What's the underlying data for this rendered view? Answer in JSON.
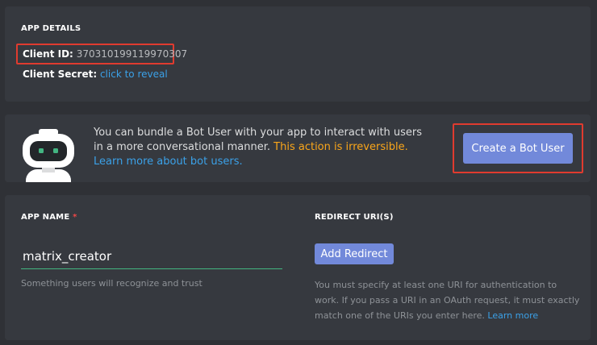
{
  "app_details": {
    "heading": "APP DETAILS",
    "client_id_label": "Client ID:",
    "client_id_value": "370310199119970307",
    "client_secret_label": "Client Secret:",
    "client_secret_link": "click to reveal"
  },
  "bot_user": {
    "description": "You can bundle a Bot User with your app to interact with users in a more conversational manner.",
    "warning": "This action is irreversible.",
    "learn_more": "Learn more about bot users.",
    "create_button": "Create a Bot User"
  },
  "app_name": {
    "heading": "APP NAME",
    "required_marker": "*",
    "value": "matrix_creator",
    "hint": "Something users will recognize and trust"
  },
  "redirect": {
    "heading": "REDIRECT URI(S)",
    "add_button": "Add Redirect",
    "hint": "You must specify at least one URI for authentication to work. If you pass a URI in an OAuth request, it must exactly match one of the URIs you enter here.",
    "learn_more": "Learn more"
  },
  "colors": {
    "background": "#2f3136",
    "panel": "#36393f",
    "blurple": "#7289da",
    "link": "#3ba1e8",
    "warning": "#faa61a",
    "annotation_red": "#e03b2f",
    "input_underline": "#43b581"
  }
}
